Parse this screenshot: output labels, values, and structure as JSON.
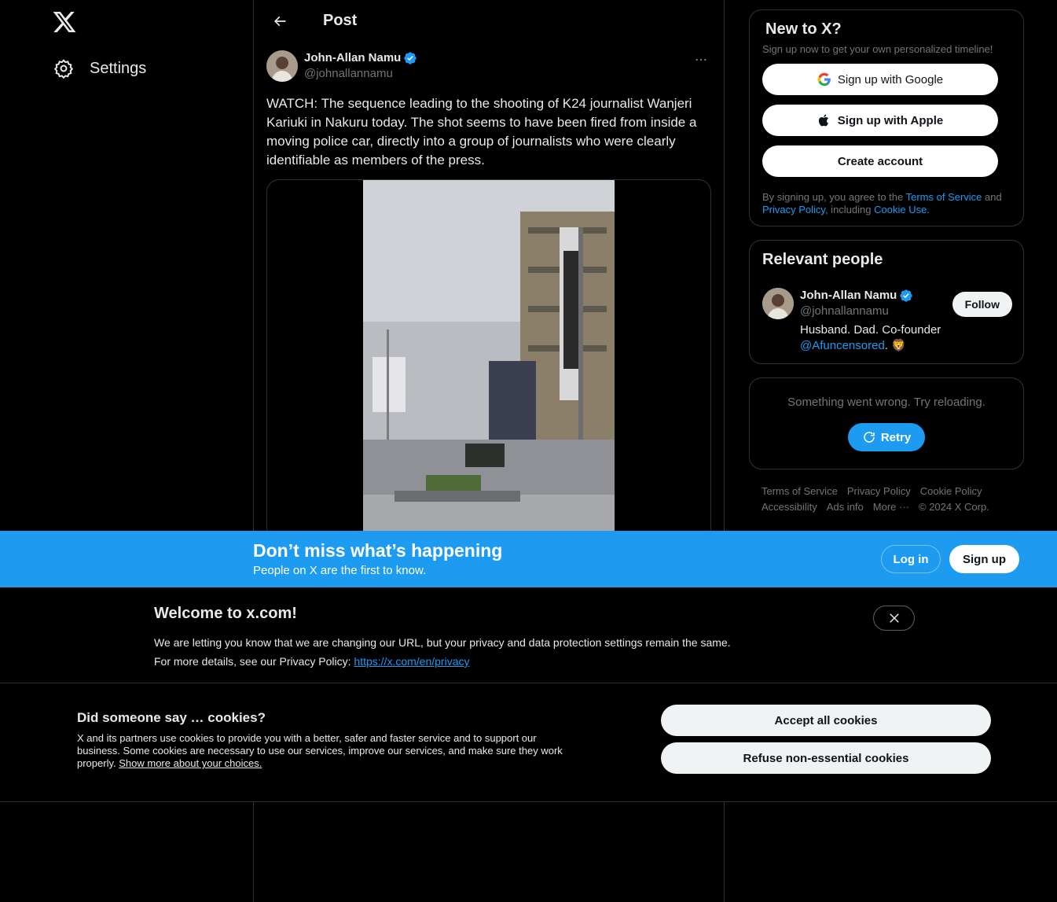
{
  "nav": {
    "settings_label": "Settings"
  },
  "header": {
    "title": "Post"
  },
  "post": {
    "author_name": "John-Allan Namu",
    "author_handle": "@johnallannamu",
    "text": "WATCH: The sequence leading to the shooting of K24 journalist Wanjeri Kariuki in Nakuru today. The shot seems to have been fired from inside a moving police car, directly into a group of journalists who were clearly identifiable as members of the press."
  },
  "signup_card": {
    "title": "New to X?",
    "subtitle": "Sign up now to get your own personalized timeline!",
    "google_label": "Sign up with Google",
    "apple_label": "Sign up with Apple",
    "create_label": "Create account",
    "legal_prefix": "By signing up, you agree to the ",
    "terms_label": "Terms of Service",
    "legal_and": " and ",
    "privacy_label": "Privacy Policy",
    "legal_including": ", including ",
    "cookie_label": "Cookie Use."
  },
  "relevant": {
    "title": "Relevant people",
    "name": "John-Allan Namu",
    "handle": "@johnallannamu",
    "bio": "Husband. Dad. Co-founder ",
    "bio_link": "@Afuncensored",
    "bio_suffix": ". 🦁",
    "follow_label": "Follow"
  },
  "error_card": {
    "text": "Something went wrong. Try reloading.",
    "retry_label": "Retry"
  },
  "footer": {
    "terms": "Terms of Service",
    "privacy": "Privacy Policy",
    "cookie": "Cookie Policy",
    "accessibility": "Accessibility",
    "ads": "Ads info",
    "more": "More ···",
    "copyright": "© 2024 X Corp."
  },
  "login_bar": {
    "title": "Don’t miss what’s happening",
    "subtitle": "People on X are the first to know.",
    "login_label": "Log in",
    "signup_label": "Sign up"
  },
  "welcome": {
    "title": "Welcome to x.com!",
    "line1": "We are letting you know that we are changing our URL, but your privacy and data protection settings remain the same.",
    "line2_prefix": "For more details, see our Privacy Policy: ",
    "link": "https://x.com/en/privacy"
  },
  "cookies": {
    "title": "Did someone say … cookies?",
    "text": "X and its partners use cookies to provide you with a better, safer and faster service and to support our business. Some cookies are necessary to use our services, improve our services, and make sure they work properly. ",
    "link": "Show more about your choices.",
    "accept_label": "Accept all cookies",
    "refuse_label": "Refuse non-essential cookies"
  },
  "colors": {
    "accent": "#1d9bf0",
    "background": "#000000",
    "muted": "#71767b"
  }
}
